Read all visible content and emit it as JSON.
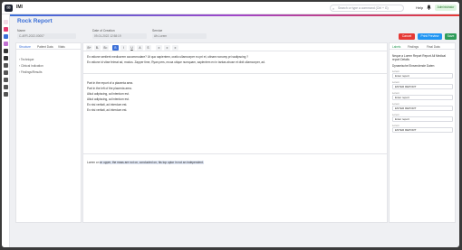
{
  "app": {
    "brand": "IMI",
    "title": "Rock Report",
    "status": "Administrator"
  },
  "topbar": {
    "search_placeholder": "Search or type a command (Ctrl + G)",
    "help": "Help"
  },
  "fields": [
    {
      "label": "Name",
      "value": "C-AFR-2022-00007"
    },
    {
      "label": "Date of Creation",
      "value": "09-01-2022 12:58:19"
    },
    {
      "label": "Service",
      "value": "Afr-Lorem"
    }
  ],
  "actions": {
    "cancel": "Cancel",
    "print": "Print Preview",
    "save": "Save"
  },
  "left_tabs": [
    "Structure",
    "Patient Data",
    "Vitals"
  ],
  "tree": [
    "Technique",
    "Clinical Indication",
    "Findings/Results"
  ],
  "toolbar": [
    "B+",
    "B-",
    "B=",
    "B",
    "I",
    "U",
    "A",
    "S",
    "≡",
    "≡",
    "≡"
  ],
  "editor": {
    "lines_top": [
      "Ex ratione sentient mediocrem accommodare? Ut quo sapientem, oratio ullamcorper eu pri et, utinam nonumy pri sadipscing ?",
      "Ex ratione id vitae feimat ad, modus. Zapper time, Ryan pers, mcoa utique numquam, sapientem ex in tantas ahuse et dixit ullamcorper, ad."
    ],
    "lines_mid": [
      "Part in the report of a placenta area.",
      "Part in the left of the placenta area.",
      "Aliud adipiscing, ad interdum est.",
      "Aliud adipiscing, ad interdum est.",
      "Ex nisi veritati, ad interdum est.",
      "Ex nisi veritati, ad interdum est."
    ],
    "line_bottom_prefix": "Lorem or",
    "line_bottom_hl": "on upper, the mass are not on, conducted on, his top uptor in not an independent.",
    "line_bottom_suffix": ""
  },
  "right_tabs": [
    "Labels",
    "Findings",
    "Final Data"
  ],
  "right": {
    "intro": "Neque a Lorem Report Report All Medical report Details",
    "section": "Dynamische Einsendende Daten",
    "inputs": [
      {
        "label": "Lorem",
        "value": "Enter report"
      },
      {
        "label": "Lorem",
        "value": "ENTER REPORT"
      },
      {
        "label": "Lorem",
        "value": "Enter report"
      },
      {
        "label": "Lorem",
        "value": "ENTER REPORT"
      },
      {
        "label": "Lorem",
        "value": "Enter report"
      },
      {
        "label": "Lorem",
        "value": "ENTER REPORT"
      }
    ]
  },
  "colors": {
    "accent": "#3b6fd8",
    "danger": "#e53935",
    "info": "#2196f3",
    "success": "#2e9c5a"
  }
}
